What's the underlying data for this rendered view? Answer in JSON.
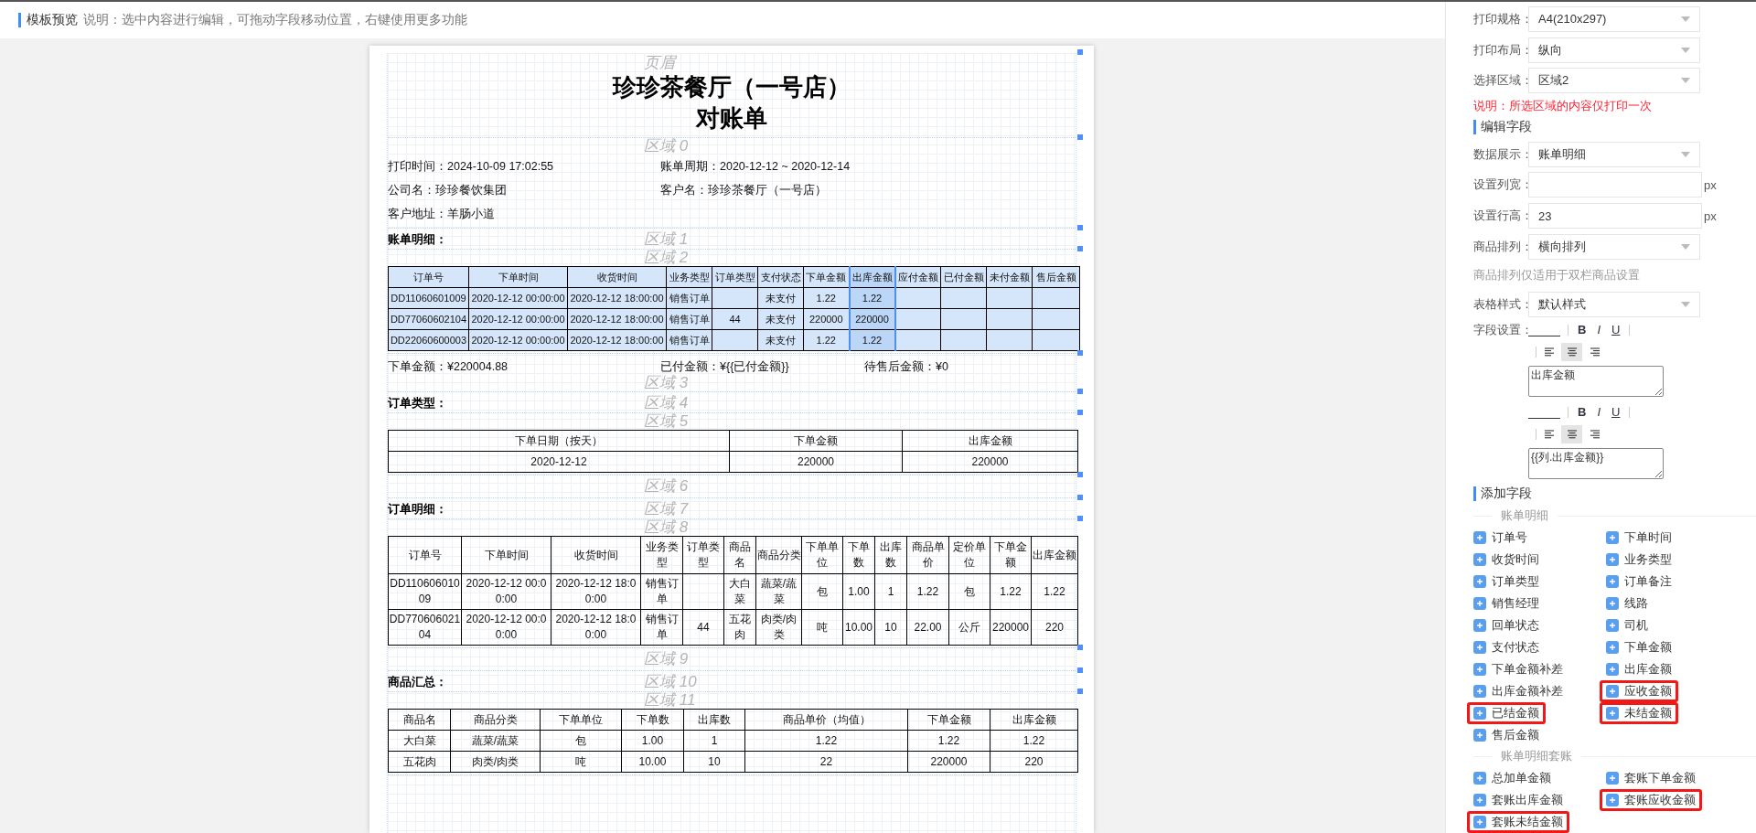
{
  "header": {
    "title": "模板预览",
    "note": "说明：选中内容进行编辑，可拖动字段移动位置，右键使用更多功能"
  },
  "paper": {
    "regions": [
      {
        "kind": "header",
        "label": "页眉",
        "title": "珍珍茶餐厅（一号店）",
        "subtitle": "对账单"
      },
      {
        "kind": "info",
        "label": "区域 0",
        "lines": [
          [
            "打印时间：2024-10-09 17:02:55",
            "账单周期：2020-12-12 ~ 2020-12-14"
          ],
          [
            "公司名：珍珍餐饮集团",
            "客户名：珍珍茶餐厅（一号店）"
          ],
          [
            "客户地址：羊肠小道"
          ]
        ]
      },
      {
        "kind": "section_title",
        "label": "区域 1",
        "text": "账单明细："
      },
      {
        "kind": "table",
        "label": "区域 2",
        "selected": true,
        "columns": [
          {
            "label": "订单号",
            "selected": false
          },
          {
            "label": "下单时间",
            "selected": false
          },
          {
            "label": "收货时间",
            "selected": false
          },
          {
            "label": "业务类型",
            "selected": false
          },
          {
            "label": "订单类型",
            "selected": false
          },
          {
            "label": "支付状态",
            "selected": false
          },
          {
            "label": "下单金额",
            "selected": false
          },
          {
            "label": "出库金额",
            "selected": true
          },
          {
            "label": "应付金额",
            "selected": false
          },
          {
            "label": "已付金额",
            "selected": false
          },
          {
            "label": "未付金额",
            "selected": false
          },
          {
            "label": "售后金额",
            "selected": false
          }
        ],
        "rows": [
          [
            "DD11060601009",
            "2020-12-12 00:00:00",
            "2020-12-12 18:00:00",
            "销售订单",
            "",
            "未支付",
            "1.22",
            "1.22",
            "",
            "",
            "",
            ""
          ],
          [
            "DD77060602104",
            "2020-12-12 00:00:00",
            "2020-12-12 18:00:00",
            "销售订单",
            "44",
            "未支付",
            "220000",
            "220000",
            "",
            "",
            "",
            ""
          ],
          [
            "DD22060600003",
            "2020-12-12 00:00:00",
            "2020-12-12 18:00:00",
            "销售订单",
            "",
            "未支付",
            "1.22",
            "1.22",
            "",
            "",
            "",
            ""
          ]
        ]
      },
      {
        "kind": "totals",
        "label": "区域 3",
        "items": [
          "下单金额：¥220004.88",
          "已付金额：¥{{已付金额}}",
          "待售后金额：¥0"
        ]
      },
      {
        "kind": "section_title",
        "label": "区域 4",
        "text": "订单类型："
      },
      {
        "kind": "table",
        "label": "区域 5",
        "selected": false,
        "columns": [
          {
            "label": "下单日期（按天）",
            "selected": false
          },
          {
            "label": "下单金额",
            "selected": false
          },
          {
            "label": "出库金额",
            "selected": false
          }
        ],
        "rows": [
          [
            "2020-12-12",
            "220000",
            "220000"
          ]
        ]
      },
      {
        "kind": "blank",
        "label": "区域 6"
      },
      {
        "kind": "section_title",
        "label": "区域 7",
        "text": "订单明细："
      },
      {
        "kind": "table",
        "label": "区域 8",
        "selected": false,
        "columns": [
          {
            "label": "订单号",
            "selected": false
          },
          {
            "label": "下单时间",
            "selected": false
          },
          {
            "label": "收货时间",
            "selected": false
          },
          {
            "label": "业务类型",
            "selected": false
          },
          {
            "label": "订单类型",
            "selected": false
          },
          {
            "label": "商品名",
            "selected": false
          },
          {
            "label": "商品分类",
            "selected": false
          },
          {
            "label": "下单单位",
            "selected": false
          },
          {
            "label": "下单数",
            "selected": false
          },
          {
            "label": "出库数",
            "selected": false
          },
          {
            "label": "商品单价",
            "selected": false
          },
          {
            "label": "定价单位",
            "selected": false
          },
          {
            "label": "下单金额",
            "selected": false
          },
          {
            "label": "出库金额",
            "selected": false
          }
        ],
        "rows": [
          [
            "DD11060601009",
            "2020-12-12 00:00:00",
            "2020-12-12 18:00:00",
            "销售订单",
            "",
            "大白菜",
            "蔬菜/蔬菜",
            "包",
            "1.00",
            "1",
            "1.22",
            "包",
            "1.22",
            "1.22"
          ],
          [
            "DD77060602104",
            "2020-12-12 00:00:00",
            "2020-12-12 18:00:00",
            "销售订单",
            "44",
            "五花肉",
            "肉类/肉类",
            "吨",
            "10.00",
            "10",
            "22.00",
            "公斤",
            "220000",
            "220"
          ]
        ]
      },
      {
        "kind": "blank",
        "label": "区域 9"
      },
      {
        "kind": "section_title",
        "label": "区域 10",
        "text": "商品汇总："
      },
      {
        "kind": "table",
        "label": "区域 11",
        "selected": false,
        "columns": [
          {
            "label": "商品名",
            "selected": false
          },
          {
            "label": "商品分类",
            "selected": false
          },
          {
            "label": "下单单位",
            "selected": false
          },
          {
            "label": "下单数",
            "selected": false
          },
          {
            "label": "出库数",
            "selected": false
          },
          {
            "label": "商品单价（均值）",
            "selected": false
          },
          {
            "label": "下单金额",
            "selected": false
          },
          {
            "label": "出库金额",
            "selected": false
          }
        ],
        "rows": [
          [
            "大白菜",
            "蔬菜/蔬菜",
            "包",
            "1.00",
            "1",
            "1.22",
            "1.22",
            "1.22"
          ],
          [
            "五花肉",
            "肉类/肉类",
            "吨",
            "10.00",
            "10",
            "22",
            "220000",
            "220"
          ]
        ]
      }
    ]
  },
  "settings": {
    "top_fields": [
      {
        "label": "打印规格：",
        "value": "A4(210x297)"
      },
      {
        "label": "打印布局：",
        "value": "纵向"
      },
      {
        "label": "选择区域：",
        "value": "区域2"
      }
    ],
    "warning": "说明：所选区域的内容仅打印一次",
    "edit_title": "编辑字段",
    "edit_fields": [
      {
        "kind": "select",
        "label": "数据展示：",
        "value": "账单明细"
      },
      {
        "kind": "input",
        "label": "设置列宽：",
        "unit": "px"
      },
      {
        "kind": "input",
        "label": "设置行高：",
        "value": "23",
        "unit": "px"
      },
      {
        "kind": "select",
        "label": "商品排列：",
        "value": "横向排列"
      },
      {
        "kind": "hint",
        "text": "商品排列仅适用于双栏商品设置"
      },
      {
        "kind": "select",
        "label": "表格样式：",
        "value": "默认样式"
      }
    ],
    "format_label": "字段设置：",
    "formats": [
      {
        "bold": "B",
        "italic": "I",
        "underline": "U",
        "aligns": [
          {
            "selected": false
          },
          {
            "selected": true
          },
          {
            "selected": false
          }
        ],
        "text": "出库金额"
      },
      {
        "bold": "B",
        "italic": "I",
        "underline": "U",
        "aligns": [
          {
            "selected": false
          },
          {
            "selected": true
          },
          {
            "selected": false
          }
        ],
        "text": "{{列.出库金额}}"
      }
    ],
    "add_title": "添加字段",
    "groups": [
      {
        "title": "账单明细",
        "items": [
          {
            "label": "订单号",
            "highlighted": false
          },
          {
            "label": "下单时间",
            "highlighted": false
          },
          {
            "label": "收货时间",
            "highlighted": false
          },
          {
            "label": "业务类型",
            "highlighted": false
          },
          {
            "label": "订单类型",
            "highlighted": false
          },
          {
            "label": "订单备注",
            "highlighted": false
          },
          {
            "label": "销售经理",
            "highlighted": false
          },
          {
            "label": "线路",
            "highlighted": false
          },
          {
            "label": "回单状态",
            "highlighted": false
          },
          {
            "label": "司机",
            "highlighted": false
          },
          {
            "label": "支付状态",
            "highlighted": false
          },
          {
            "label": "下单金额",
            "highlighted": false
          },
          {
            "label": "下单金额补差",
            "highlighted": false
          },
          {
            "label": "出库金额",
            "highlighted": false
          },
          {
            "label": "出库金额补差",
            "highlighted": false
          },
          {
            "label": "应收金额",
            "highlighted": true
          },
          {
            "label": "已结金额",
            "highlighted": true
          },
          {
            "label": "未结金额",
            "highlighted": true
          },
          {
            "label": "售后金额",
            "highlighted": false
          }
        ]
      },
      {
        "title": "账单明细套账",
        "items": [
          {
            "label": "总加单金额",
            "highlighted": false
          },
          {
            "label": "套账下单金额",
            "highlighted": false
          },
          {
            "label": "套账出库金额",
            "highlighted": false
          },
          {
            "label": "套账应收金额",
            "highlighted": true
          },
          {
            "label": "套账未结金额",
            "highlighted": true
          }
        ]
      }
    ]
  }
}
